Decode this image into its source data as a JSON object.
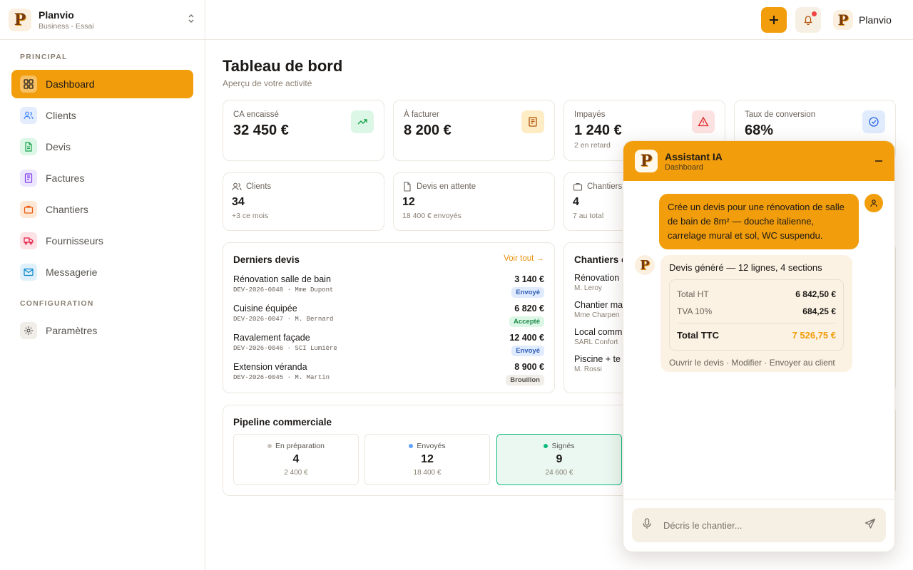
{
  "brand": {
    "name": "Planvio",
    "plan": "Business - Essai",
    "logo_letter": "P"
  },
  "sidebar": {
    "section_principal": "PRINCIPAL",
    "section_config": "CONFIGURATION",
    "items": [
      {
        "label": "Dashboard",
        "icon": "grid-icon",
        "active": true
      },
      {
        "label": "Clients",
        "icon": "users-icon",
        "color": "#3b82f6"
      },
      {
        "label": "Devis",
        "icon": "file-text-icon",
        "color": "#16a34a"
      },
      {
        "label": "Factures",
        "icon": "invoice-icon",
        "color": "#7c3aed"
      },
      {
        "label": "Chantiers",
        "icon": "briefcase-icon",
        "color": "#ea580c"
      },
      {
        "label": "Fournisseurs",
        "icon": "truck-icon",
        "color": "#e11d48"
      },
      {
        "label": "Messagerie",
        "icon": "mail-icon",
        "color": "#0284c7"
      }
    ],
    "settings_label": "Paramètres"
  },
  "topbar": {
    "user_name": "Planvio"
  },
  "page": {
    "title": "Tableau de bord",
    "subtitle": "Aperçu de votre activité"
  },
  "kpis": [
    {
      "label": "CA encaissé",
      "value": "32 450 €",
      "icon": "trending-up-icon"
    },
    {
      "label": "À facturer",
      "value": "8 200 €",
      "icon": "document-icon"
    },
    {
      "label": "Impayés",
      "value": "1 240 €",
      "sub": "2 en retard",
      "icon": "warning-icon"
    },
    {
      "label": "Taux de conversion",
      "value": "68%",
      "icon": "check-circle-icon"
    }
  ],
  "stats": [
    {
      "label": "Clients",
      "value": "34",
      "sub": "+3 ce mois"
    },
    {
      "label": "Devis en attente",
      "value": "12",
      "sub": "18 400 € envoyés"
    },
    {
      "label": "Chantiers",
      "value": "4",
      "sub": "7 au total"
    }
  ],
  "derniers_devis": {
    "title": "Derniers devis",
    "link": "Voir tout →",
    "rows": [
      {
        "name": "Rénovation salle de bain",
        "ref": "DEV-2026-0048 · Mme Dupont",
        "amount": "3 140 €",
        "status": "Envoyé"
      },
      {
        "name": "Cuisine équipée",
        "ref": "DEV-2026-0047 · M. Bernard",
        "amount": "6 820 €",
        "status": "Accepté"
      },
      {
        "name": "Ravalement façade",
        "ref": "DEV-2026-0046 · SCI Lumière",
        "amount": "12 400 €",
        "status": "Envoyé"
      },
      {
        "name": "Extension véranda",
        "ref": "DEV-2026-0045 · M. Martin",
        "amount": "8 900 €",
        "status": "Brouillon"
      }
    ]
  },
  "chantiers": {
    "title": "Chantiers e",
    "rows": [
      {
        "name": "Rénovation",
        "sub": "M. Leroy"
      },
      {
        "name": "Chantier ma",
        "sub": "Mme Charpen"
      },
      {
        "name": "Local comm",
        "sub": "SARL Confort"
      },
      {
        "name": "Piscine + te",
        "sub": "M. Rossi"
      }
    ]
  },
  "pipeline": {
    "title": "Pipeline commerciale",
    "stages": [
      {
        "label": "En préparation",
        "value": "4",
        "amount": "2 400 €",
        "dot": "#c9c4bd"
      },
      {
        "label": "Envoyés",
        "value": "12",
        "amount": "18 400 €",
        "dot": "#60a5fa"
      },
      {
        "label": "Signés",
        "value": "9",
        "amount": "24 600 €",
        "dot": "#10b981"
      }
    ]
  },
  "assistant": {
    "title": "Assistant IA",
    "context": "Dashboard",
    "user_message": "Crée un devis pour une rénovation de salle de bain de 8m² — douche italienne, carrelage mural et sol, WC suspendu.",
    "bot_message": "Devis généré — 12 lignes, 4 sections",
    "total_ht_label": "Total HT",
    "total_ht": "6 842,50 €",
    "tva_label": "TVA 10%",
    "tva": "684,25 €",
    "total_ttc_label": "Total TTC",
    "total_ttc": "7 526,75 €",
    "actions": "Ouvrir le devis · Modifier · Envoyer au client",
    "input_placeholder": "Décris le chantier..."
  }
}
